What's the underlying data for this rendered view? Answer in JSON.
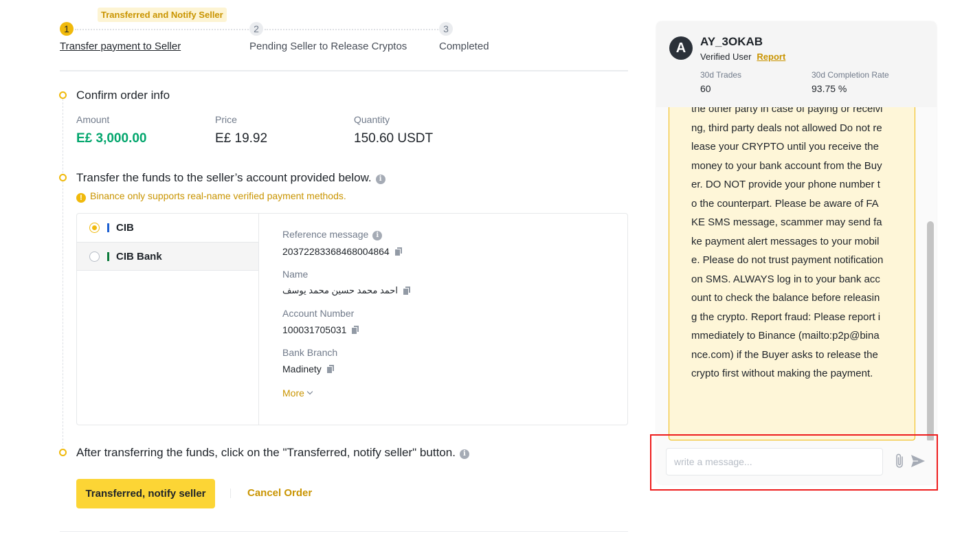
{
  "stepper": {
    "badge": "Transferred and Notify Seller",
    "steps": [
      {
        "num": "1",
        "label": "Transfer payment to Seller",
        "active": true
      },
      {
        "num": "2",
        "label": "Pending Seller to Release Cryptos",
        "active": false
      },
      {
        "num": "3",
        "label": "Completed",
        "active": false
      }
    ]
  },
  "confirm": {
    "title": "Confirm order info",
    "amount_label": "Amount",
    "amount_value": "E£ 3,000.00",
    "price_label": "Price",
    "price_value": "E£ 19.92",
    "quantity_label": "Quantity",
    "quantity_value": "150.60 USDT"
  },
  "transfer": {
    "title": "Transfer the funds to the seller’s account provided below.",
    "warning": "Binance only supports real-name verified payment methods.",
    "methods": [
      {
        "name": "CIB",
        "selected": true,
        "bar_color": "#1c5fd1"
      },
      {
        "name": "CIB Bank",
        "selected": false,
        "bar_color": "#0b7a3a"
      }
    ],
    "details": {
      "reference_label": "Reference message",
      "reference_value": "20372283368468004864",
      "name_label": "Name",
      "name_value": "احمد محمد حسين محمد يوسف",
      "account_label": "Account Number",
      "account_value": "100031705031",
      "branch_label": "Bank Branch",
      "branch_value": "Madinety",
      "more_label": "More"
    }
  },
  "after": {
    "title": "After transferring the funds, click on the \"Transferred, notify seller\" button.",
    "primary_button": "Transferred, notify seller",
    "cancel_button": "Cancel Order"
  },
  "chat": {
    "avatar_letter": "A",
    "username": "AY_3OKAB",
    "verified": "Verified User",
    "report": "Report",
    "trades_label": "30d Trades",
    "trades_value": "60",
    "completion_label": "30d Completion Rate",
    "completion_value": "93.75 %",
    "message": "the other party in case of paying or receiving, third party deals not allowed Do not release your CRYPTO until you receive the money to your bank account from the Buyer. DO NOT provide your phone number to the counterpart. Please be aware of FAKE SMS message, scammer may send fake payment alert messages to your mobile. Please do not trust payment notification on SMS. ALWAYS log in to your bank account to check the balance before releasing the crypto. Report fraud: Please report immediately to Binance (mailto:p2p@binance.com) if the Buyer asks to release the crypto first without making the payment.",
    "input_placeholder": "write a message...",
    "input_value": ""
  },
  "colors": {
    "accent": "#f0b90b",
    "primary_button": "#fcd535",
    "link": "#c99400",
    "amount_green": "#03a66d",
    "highlight_red": "#ee1c1c"
  }
}
